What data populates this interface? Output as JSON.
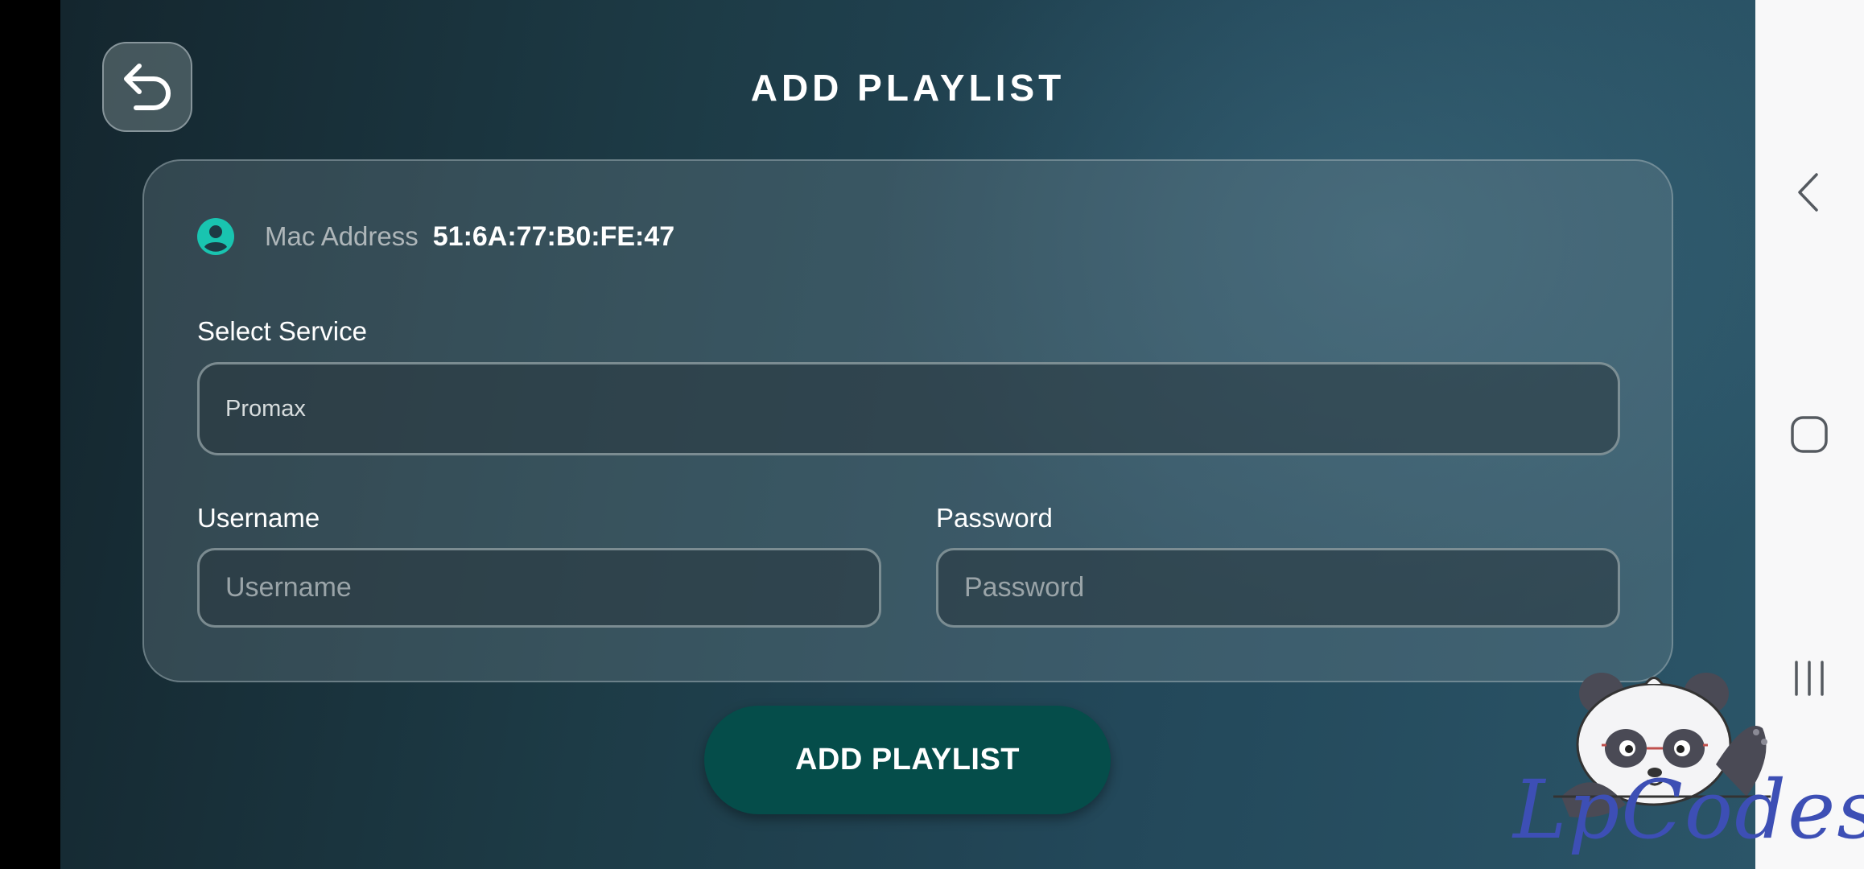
{
  "header": {
    "title": "ADD PLAYLIST",
    "back_icon": "back-arrow-icon"
  },
  "device": {
    "mac_label": "Mac Address",
    "mac_value": "51:6A:77:B0:FE:47",
    "icon": "account-circle-icon",
    "icon_color": "#19c4b0"
  },
  "form": {
    "service_label": "Select Service",
    "service_value": "Promax",
    "username_label": "Username",
    "username_placeholder": "Username",
    "username_value": "",
    "password_label": "Password",
    "password_placeholder": "Password",
    "password_value": ""
  },
  "actions": {
    "add_label": "ADD PLAYLIST",
    "add_color": "#054d4a"
  },
  "system_nav": {
    "back_icon": "nav-back-icon",
    "home_icon": "nav-home-icon",
    "recents_icon": "nav-recents-icon"
  },
  "watermark": {
    "text": "LpCodes",
    "mascot": "panda-mascot"
  }
}
